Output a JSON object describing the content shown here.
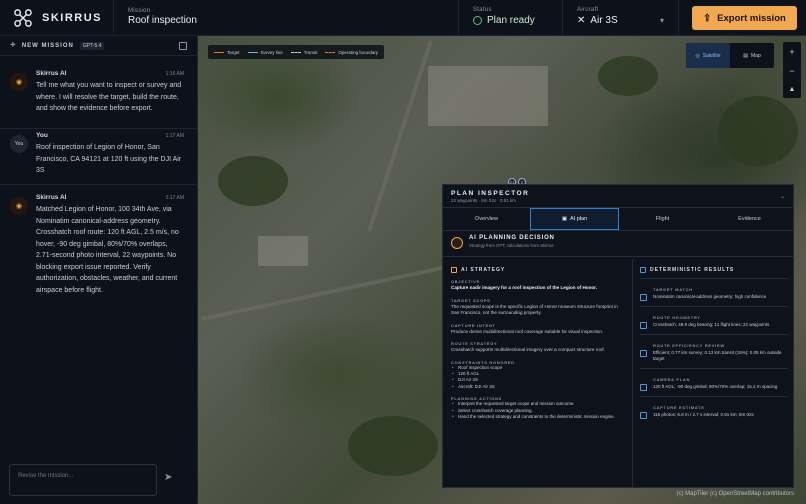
{
  "chart_data": {
    "type": "table",
    "title": "PLAN INSPECTOR",
    "rows": [
      {
        "label": "TARGET MATCH",
        "value": "Nominatim canonical-address geometry; high confidence"
      },
      {
        "label": "ROUTE GEOMETRY",
        "value": "Crosshatch; 48.9 deg bearing; 11 flight lines; 22 waypoints"
      },
      {
        "label": "ROUTE EFFICIENCY REVIEW",
        "value": "Efficient; 0.77 km survey; 0.13 km transit (15%); 0.05 km outside target"
      },
      {
        "label": "CAMERA PLAN",
        "value": "120 ft AGL; -90 deg gimbal; 80%/70% overlap; 15.2 m spacing"
      },
      {
        "label": "CAPTURE ESTIMATE",
        "value": "115 photos; 6.8 m / 2.7 s interval; 0.91 km; 6m 02s"
      }
    ]
  },
  "topbar": {
    "brand": "SKIRRUS",
    "mission_label": "Mission",
    "mission_name": "Roof inspection",
    "status_label": "Status",
    "status_value": "Plan ready",
    "aircraft_label": "Aircraft",
    "aircraft_value": "Air 3S",
    "export_label": "Export mission"
  },
  "left": {
    "new_mission": "NEW MISSION",
    "model_badge": "GPT-5.4",
    "messages": [
      {
        "who": "Skirrus AI",
        "time": "1:16 AM",
        "text": "Tell me what you want to inspect or survey and where. I will resolve the target, build the route, and show the evidence before export."
      },
      {
        "who": "You",
        "time": "1:17 AM",
        "avatar": "You",
        "text": "Roof inspection of Legion of Honor, San Francisco, CA 94121 at 120 ft using the DJI Air 3S"
      },
      {
        "who": "Skirrus AI",
        "time": "1:17 AM",
        "text": "Matched Legion of Honor, 100 34th Ave, via Nominatim canonical-address geometry. Crosshatch roof route: 120 ft AGL, 2.5 m/s, no hover, -90 deg gimbal, 80%/70% overlaps, 2.71-second photo interval, 22 waypoints. No blocking export issue reported. Verify authorization, obstacles, weather, and current airspace before flight."
      }
    ],
    "input_placeholder": "Revise the mission..."
  },
  "map": {
    "legend": [
      "Target",
      "Survey line",
      "Transit",
      "Operating boundary"
    ],
    "layer_satellite": "Satellite",
    "layer_map": "Map",
    "attribution": "(c) MapTiler (c) OpenStreetMap contributors"
  },
  "inspector": {
    "title": "PLAN INSPECTOR",
    "subtitle": "22 waypoints · 6m 02s · 0.91 km",
    "tabs": [
      "Overview",
      "AI plan",
      "Flight",
      "Evidence"
    ],
    "decision_title": "AI PLANNING DECISION",
    "decision_sub": "Strategy from GPT; calculations from Skirrus",
    "strategy_title": "AI STRATEGY",
    "objective_k": "OBJECTIVE",
    "objective_v": "Capture nadir imagery for a roof inspection of the Legion of Honor.",
    "scope_k": "TARGET SCOPE",
    "scope_v": "The requested scope is the specific Legion of Honor museum structure footprint in San Francisco, not the surrounding property.",
    "intent_k": "CAPTURE INTENT",
    "intent_v": "Produce dense multidirectional roof coverage suitable for visual inspection.",
    "route_k": "ROUTE STRATEGY",
    "route_v": "Crosshatch supports multidirectional imagery over a compact structure roof.",
    "constraints_k": "CONSTRAINTS HONORED",
    "constraints": [
      "Roof inspection scope",
      "120 ft AGL",
      "DJI Air 3S",
      "Aircraft: DJI Air 3S"
    ],
    "actions_k": "PLANNING ACTIONS",
    "actions": [
      "Interpret the requested target scope and mission outcome.",
      "Select crosshatch coverage planning.",
      "Hand the selected strategy and constraints to the deterministic mission engine."
    ],
    "det_title": "DETERMINISTIC RESULTS"
  }
}
